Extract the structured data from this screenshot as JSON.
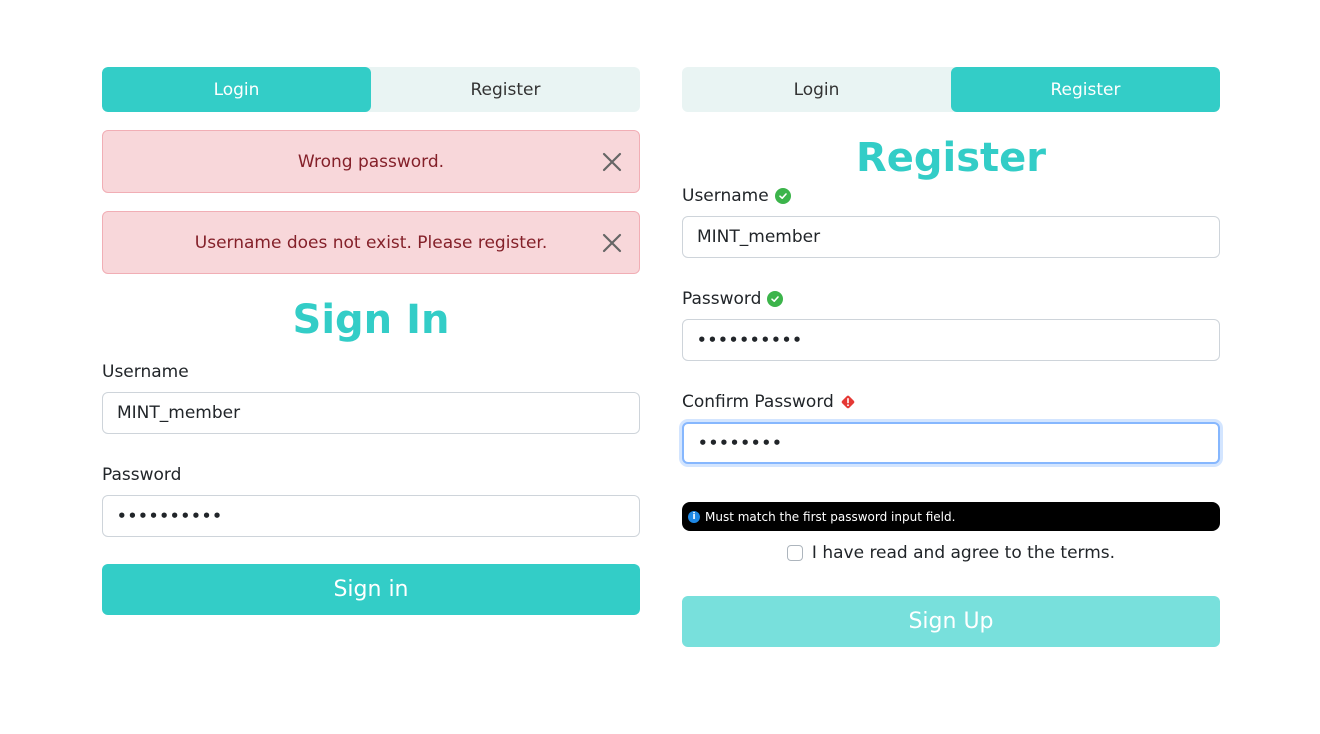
{
  "login_panel": {
    "tabs": [
      {
        "label": "Login",
        "active": true
      },
      {
        "label": "Register",
        "active": false
      }
    ],
    "alerts": [
      {
        "message": "Wrong password.",
        "close_icon": "close-icon"
      },
      {
        "message": "Username does not exist. Please register.",
        "close_icon": "close-icon"
      }
    ],
    "title": "Sign In",
    "username": {
      "label": "Username",
      "value": "MINT_member"
    },
    "password": {
      "label": "Password",
      "value": "••••••••••"
    },
    "submit_label": "Sign in"
  },
  "register_panel": {
    "tabs": [
      {
        "label": "Login",
        "active": false
      },
      {
        "label": "Register",
        "active": true
      }
    ],
    "title": "Register",
    "username": {
      "label": "Username",
      "value": "MINT_member",
      "status": "valid"
    },
    "password": {
      "label": "Password",
      "value": "••••••••••",
      "status": "valid"
    },
    "confirm_password": {
      "label": "Confirm Password",
      "value": "••••••••",
      "status": "invalid"
    },
    "hint": "Must match the first password input field.",
    "terms_label": "I have read and agree to the terms.",
    "terms_checked": false,
    "submit_label": "Sign Up",
    "submit_disabled": true
  },
  "colors": {
    "accent": "#33cdc7",
    "accent_disabled": "#78e0dc",
    "alert_bg": "#f8d7da",
    "alert_text": "#842029",
    "valid": "#3cb44b",
    "invalid": "#e53935"
  }
}
